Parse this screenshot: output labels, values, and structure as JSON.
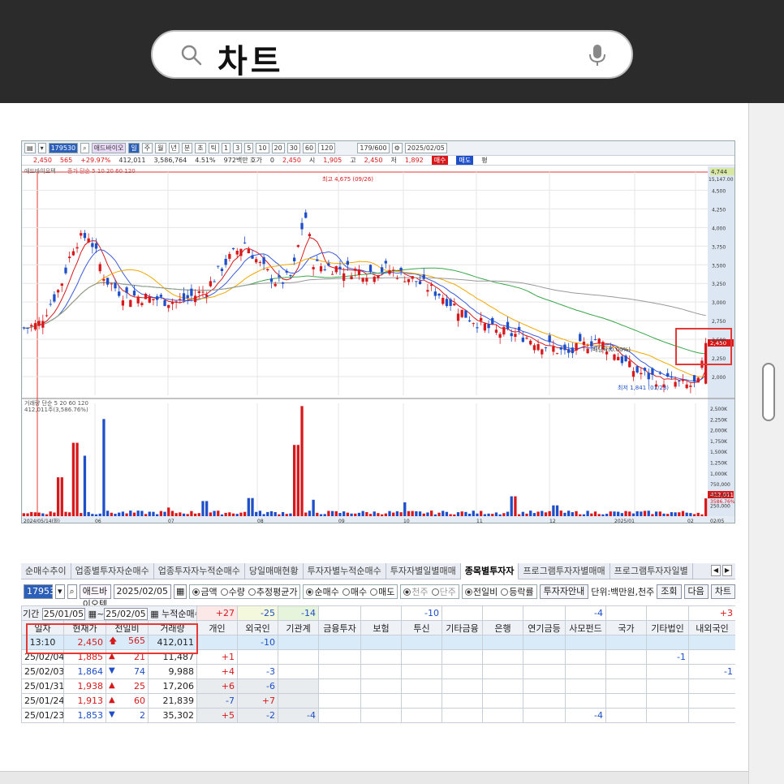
{
  "search": {
    "query": "차트"
  },
  "chart": {
    "toolbar": {
      "code": "179530",
      "name": "애드바이오",
      "periods": [
        "주",
        "월",
        "년",
        "분",
        "초",
        "틱"
      ],
      "minutes": [
        "1",
        "3",
        "5",
        "10",
        "20",
        "30",
        "60",
        "120"
      ],
      "count": "179/600",
      "date": "2025/02/05"
    },
    "quote": {
      "price": "2,450",
      "change": "565",
      "rate": "+29.97%",
      "volume": "412,011",
      "amount": "3,586,764",
      "pct": "4.51%",
      "ask_info": "972백만 호가",
      "zero": "0",
      "cur": "2,450",
      "open_label": "시",
      "open": "1,905",
      "high_label": "고",
      "high": "2,450",
      "low_label": "저",
      "low": "1,892",
      "buy": "매수",
      "sell": "매도",
      "flat": "평"
    },
    "legend_price": "애드바이오텍",
    "legend_ma": "종가 단순 5 10 20 60 120",
    "legend_volume": "거래량 단순 5 20 60 120",
    "legend_volume_value": "412,011주(3,586.76%)",
    "annotation_high": "최고 4,675 (09/26)",
    "annotation_low": "최저 1,841 (01/23)",
    "annotation_event": "배당락(0.00%)",
    "top_price": "4,744",
    "top_price2": "15,147.00",
    "price_ticks": [
      "4,500",
      "4,250",
      "4,000",
      "3,750",
      "3,500",
      "3,250",
      "3,000",
      "2,750",
      "2,500",
      "2,250",
      "2,000"
    ],
    "current_price_label": "2,450",
    "volume_ticks": [
      "2,500K",
      "2,250K",
      "2,000K",
      "1,750K",
      "1,500K",
      "1,250K",
      "1,000K",
      "750,000",
      "500,000",
      "250,000"
    ],
    "volume_current_label": "412,011",
    "volume_sub_label": "3586.76%",
    "x_labels": [
      "2024/05/14(화)",
      "06",
      "07",
      "08",
      "09",
      "10",
      "11",
      "12",
      "2025/01",
      "02",
      "02/05"
    ]
  },
  "table": {
    "tabs": [
      "순매수추이",
      "업종별투자자순매수",
      "업종투자자누적순매수",
      "당일매매현황",
      "투자자별누적순매수",
      "투자자별일별매매",
      "종목별투자자",
      "프로그램투자자별매매",
      "프로그램투자자일별"
    ],
    "active_tab": "종목별투자자",
    "code": "179530",
    "name": "애드바이오텍",
    "date": "2025/02/05",
    "radio_amount": "금액",
    "radio_qty": "수량",
    "radio_avg": "추정평균가",
    "radio_net": "순매수",
    "radio_buy": "매수",
    "radio_sell": "매도",
    "radio_thousand": "천주",
    "radio_unit": "단주",
    "radio_prev": "전일비",
    "radio_rate": "등락률",
    "btn_guide": "투자자안내",
    "unit_label": "단위:백만원,천주",
    "btn_query": "조회",
    "btn_next": "다음",
    "btn_chart": "차트",
    "period_label": "기간",
    "from": "25/01/05",
    "to": "25/02/05",
    "cum_label": "누적순매수",
    "sums": [
      "+27",
      "-25",
      "-14",
      "",
      "",
      "-10",
      "",
      "",
      "",
      "-4",
      "",
      "",
      "+3"
    ],
    "headers": [
      "일자",
      "현재가",
      "전일비",
      "거래량",
      "개인",
      "외국인",
      "기관계",
      "금융투자",
      "보험",
      "투신",
      "기타금융",
      "은행",
      "연기금등",
      "사모펀드",
      "국가",
      "기타법인",
      "내외국인"
    ],
    "rows": [
      {
        "date": "13:10",
        "price": "2,450",
        "dir": "up-arrow",
        "diff": "565",
        "vol": "412,011",
        "c": [
          "",
          "-10",
          "",
          "",
          "",
          "",
          "",
          "",
          "",
          "",
          "",
          "",
          ""
        ]
      },
      {
        "date": "25/02/04",
        "price": "1,885",
        "dir": "up",
        "diff": "21",
        "vol": "11,487",
        "c": [
          "+1",
          "",
          "",
          "",
          "",
          "",
          "",
          "",
          "",
          "",
          "",
          "-1",
          ""
        ]
      },
      {
        "date": "25/02/03",
        "price": "1,864",
        "dir": "down",
        "diff": "74",
        "vol": "9,988",
        "c": [
          "+4",
          "-3",
          "",
          "",
          "",
          "",
          "",
          "",
          "",
          "",
          "",
          "",
          "-1"
        ]
      },
      {
        "date": "25/01/31",
        "price": "1,938",
        "dir": "up",
        "diff": "25",
        "vol": "17,206",
        "c": [
          "+6",
          "-6",
          "",
          "",
          "",
          "",
          "",
          "",
          "",
          "",
          "",
          "",
          ""
        ]
      },
      {
        "date": "25/01/24",
        "price": "1,913",
        "dir": "up",
        "diff": "60",
        "vol": "21,839",
        "c": [
          "-7",
          "+7",
          "",
          "",
          "",
          "",
          "",
          "",
          "",
          "",
          "",
          "",
          ""
        ]
      },
      {
        "date": "25/01/23",
        "price": "1,853",
        "dir": "down",
        "diff": "2",
        "vol": "35,302",
        "c": [
          "+5",
          "-2",
          "-4",
          "",
          "",
          "",
          "",
          "",
          "",
          "-4",
          "",
          "",
          ""
        ]
      }
    ]
  },
  "colors": {
    "up": "#d7191c",
    "down": "#1f4fc8",
    "accent": "#2c5fb8"
  }
}
